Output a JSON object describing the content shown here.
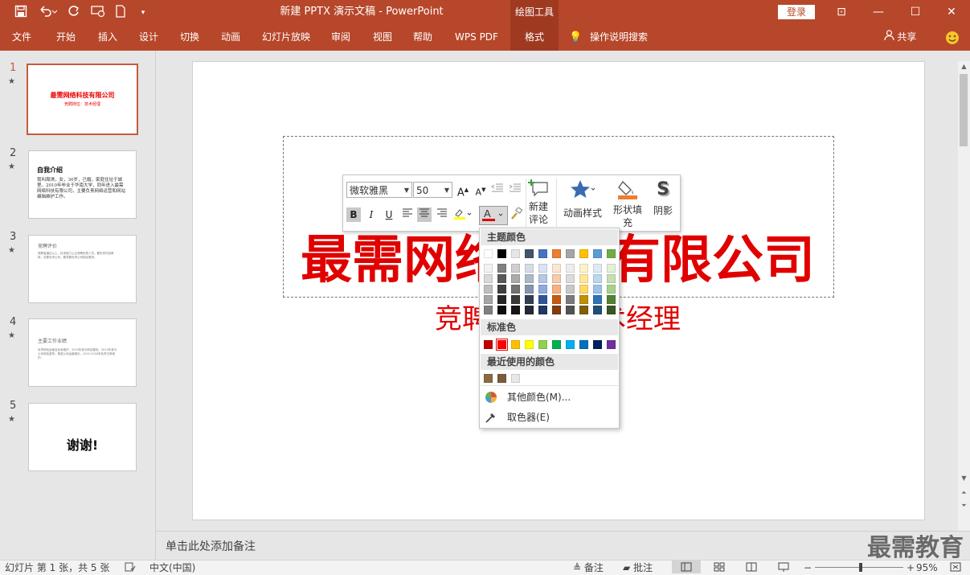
{
  "window": {
    "title": "新建 PPTX 演示文稿  -  PowerPoint",
    "context_tab": "绘图工具",
    "login": "登录",
    "controls": {
      "ribbon_display": "⊡",
      "minimize": "—",
      "maximize": "☐",
      "close": "✕"
    }
  },
  "quick_access": [
    "save-icon",
    "undo-icon",
    "redo-icon",
    "present-icon",
    "new-file-icon",
    "customize-icon"
  ],
  "tabs": [
    {
      "label": "文件"
    },
    {
      "label": "开始"
    },
    {
      "label": "插入"
    },
    {
      "label": "设计"
    },
    {
      "label": "切换"
    },
    {
      "label": "动画"
    },
    {
      "label": "幻灯片放映"
    },
    {
      "label": "审阅"
    },
    {
      "label": "视图"
    },
    {
      "label": "帮助"
    },
    {
      "label": "WPS PDF"
    },
    {
      "label": "格式"
    }
  ],
  "tell_me": "操作说明搜索",
  "share": "共享",
  "thumbnails": [
    {
      "num": "1",
      "star": "★",
      "title": "最需网络科技有限公司",
      "subtitle": "竞聘岗位：技术经理"
    },
    {
      "num": "2",
      "star": "★",
      "title": "自我介绍",
      "body": "我叫周琪，女，30岁，已婚，家庭住址于城里。2010年毕业于华南大学，同年进入最需网络科技有限公司，主要负责网络运营和网站编辑维护工作。"
    },
    {
      "num": "3",
      "star": "★",
      "title": "竞聘评价",
      "body": "竞聘者通过以上，技术能力公正竞聘优秀人员。要负责内容审核，总要负责公司。要求要负责公司指定要求。"
    },
    {
      "num": "4",
      "star": "★",
      "title": "主要工作业绩",
      "body": "负责网站运营及技术维护。2010年参与网站建设。2013年参与公司网站重构，推进公司运营增长。2015-2018年负责日常维护。"
    },
    {
      "num": "5",
      "star": "★",
      "title": "谢谢!"
    }
  ],
  "slide": {
    "title": "最需网络科技有限公司",
    "subtitle": "竞聘岗位：技术经理"
  },
  "mini_toolbar": {
    "font_name": "微软雅黑",
    "font_size": "50",
    "new_comment": [
      "新建",
      "评论"
    ],
    "animation_styles": "动画样式",
    "shape_fill": [
      "形状填",
      "充"
    ],
    "shadow": "阴影"
  },
  "color_picker": {
    "theme_header": "主题颜色",
    "standard_header": "标准色",
    "recent_header": "最近使用的颜色",
    "more_colors": "其他颜色(M)...",
    "eyedropper": "取色器(E)",
    "theme_top": [
      "#ffffff",
      "#000000",
      "#e7e6e6",
      "#44546a",
      "#4472c4",
      "#ed7d31",
      "#a5a5a5",
      "#ffc000",
      "#5b9bd5",
      "#70ad47"
    ],
    "theme_shades": [
      [
        "#f2f2f2",
        "#d9d9d9",
        "#bfbfbf",
        "#a6a6a6",
        "#808080"
      ],
      [
        "#808080",
        "#595959",
        "#404040",
        "#262626",
        "#0d0d0d"
      ],
      [
        "#d0cece",
        "#aeaaaa",
        "#757171",
        "#3a3838",
        "#171616"
      ],
      [
        "#d6dce5",
        "#adb9ca",
        "#8497b0",
        "#333f50",
        "#222a35"
      ],
      [
        "#dae3f3",
        "#b4c7e7",
        "#8faadc",
        "#2f5597",
        "#203864"
      ],
      [
        "#fbe5d6",
        "#f8cbad",
        "#f4b183",
        "#c55a11",
        "#843c0c"
      ],
      [
        "#ededed",
        "#dbdbdb",
        "#c9c9c9",
        "#7b7b7b",
        "#525252"
      ],
      [
        "#fff2cc",
        "#ffe699",
        "#ffd966",
        "#bf9000",
        "#7f6000"
      ],
      [
        "#deebf7",
        "#bdd7ee",
        "#9dc3e6",
        "#2e75b6",
        "#1f4e79"
      ],
      [
        "#e2f0d9",
        "#c5e0b4",
        "#a9d18e",
        "#548235",
        "#385723"
      ]
    ],
    "standard": [
      "#c00000",
      "#ff0000",
      "#ffc000",
      "#ffff00",
      "#92d050",
      "#00b050",
      "#00b0f0",
      "#0070c0",
      "#002060",
      "#7030a0"
    ],
    "recent": [
      "#8b6a43",
      "#7a5c3a",
      "#e8e8e8"
    ]
  },
  "notes_placeholder": "单击此处添加备注",
  "watermark": "最需教育",
  "status": {
    "slide_info": "幻灯片 第 1 张，共 5 张",
    "language": "中文(中国)",
    "notes": "备注",
    "comments": "批注",
    "zoom": "95%",
    "zoom_level": 0.52
  }
}
